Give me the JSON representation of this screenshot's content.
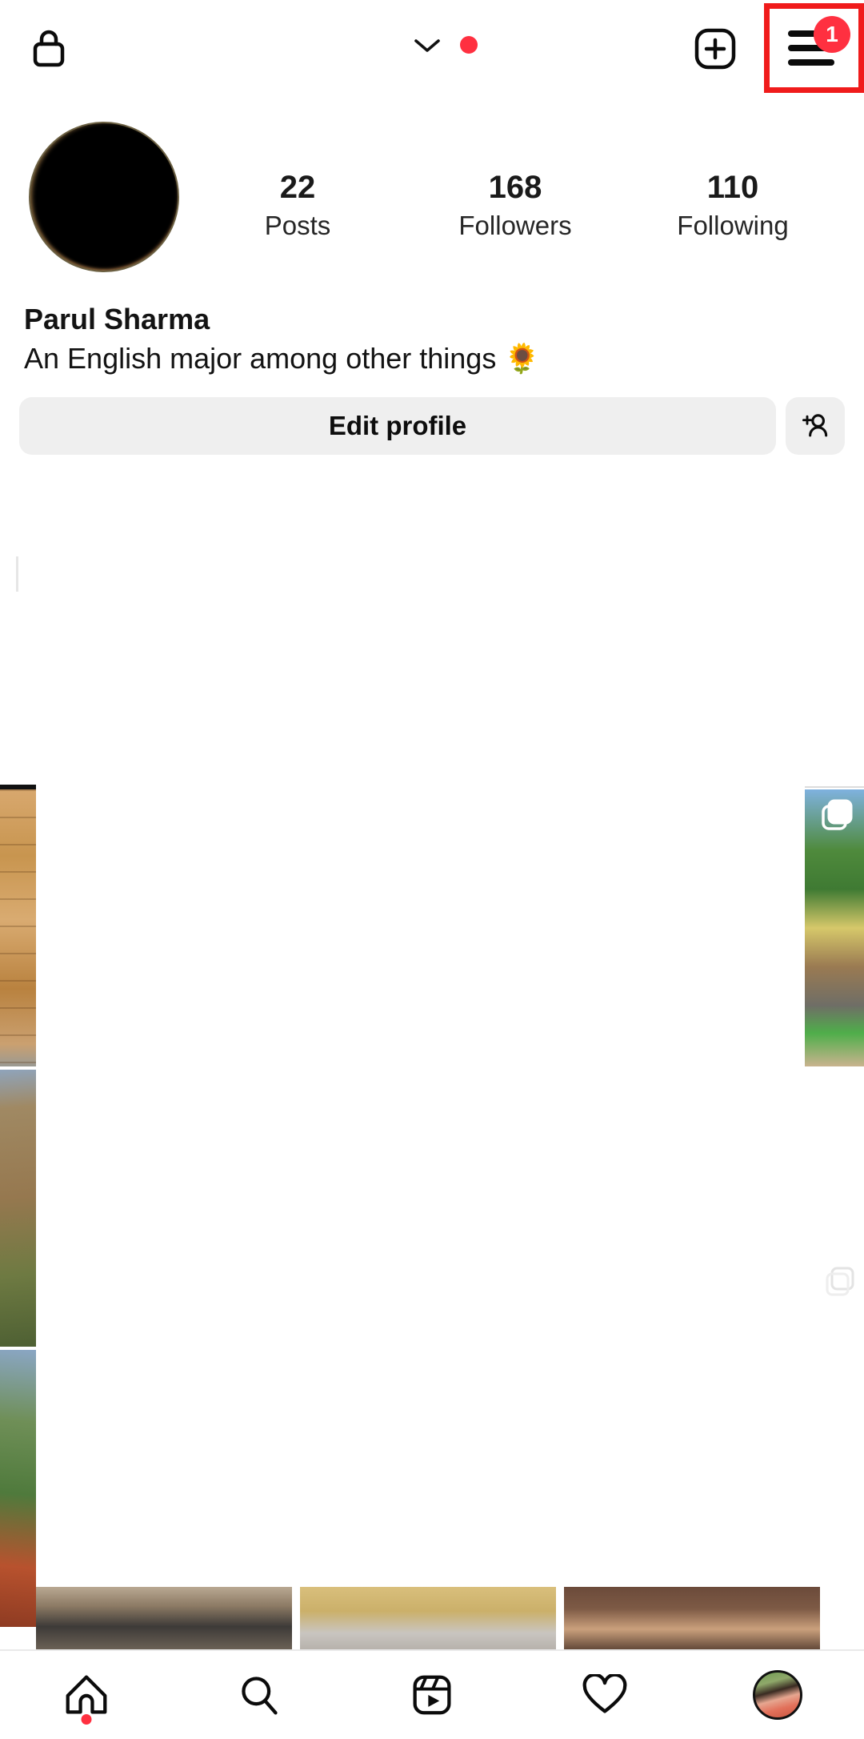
{
  "app": "instagram-profile",
  "topbar": {
    "lock_icon": "lock-icon",
    "chevron_icon": "chevron-down-icon",
    "unread_story_dot": "red-dot",
    "create_icon": "plus-square-icon",
    "menu_icon": "hamburger-menu-icon",
    "menu_badge_count": "1",
    "annotation": "red-highlight-box"
  },
  "profile": {
    "avatar": "profile-avatar",
    "full_name": "Parul Sharma",
    "bio": "An English major among other things 🌻",
    "stats": [
      {
        "value": "22",
        "label": "Posts"
      },
      {
        "value": "168",
        "label": "Followers"
      },
      {
        "value": "110",
        "label": "Following"
      }
    ]
  },
  "actions": {
    "edit_profile_label": "Edit profile",
    "add_person_icon": "add-person-icon"
  },
  "bottom_nav": {
    "items": [
      {
        "icon": "home-icon",
        "name": "nav-home",
        "has_dot": true
      },
      {
        "icon": "search-icon",
        "name": "nav-search",
        "has_dot": false
      },
      {
        "icon": "reels-icon",
        "name": "nav-reels",
        "has_dot": false
      },
      {
        "icon": "heart-icon",
        "name": "nav-activity",
        "has_dot": false
      },
      {
        "icon": "avatar-icon",
        "name": "nav-profile",
        "has_dot": false
      }
    ]
  },
  "colors": {
    "accent_red": "#FF3040",
    "annotation_red": "#F01B1B",
    "button_gray": "#EFEFEF",
    "text_primary": "#131313",
    "background": "#FFFFFF"
  }
}
